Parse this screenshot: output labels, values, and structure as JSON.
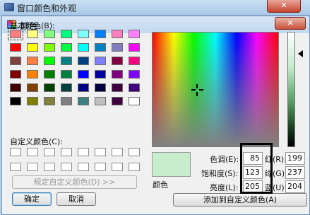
{
  "outer_window": {
    "title": "窗口颜色和外观",
    "close_label": "✕"
  },
  "dialog": {
    "title": "颜色",
    "close_label": "✕",
    "basic_colors_label": "基本颜色(B):",
    "custom_colors_label": "自定义颜色(C):",
    "define_custom_button": "规定自定义颜色(D) >>",
    "ok_button": "确定",
    "cancel_button": "取消",
    "add_custom_button": "添加到自定义颜色(A)",
    "color_solid_label": "颜色",
    "fields": {
      "hue": {
        "label": "色调(E):",
        "value": "85"
      },
      "sat": {
        "label": "饱和度(S):",
        "value": "123"
      },
      "lum": {
        "label": "亮度(L):",
        "value": "205"
      },
      "red": {
        "label": "红(R):",
        "value": "199"
      },
      "green": {
        "label": "绿(G):",
        "value": "237"
      },
      "blue": {
        "label": "蓝(U):",
        "value": "204"
      }
    }
  },
  "basic_colors": [
    "#ff8080",
    "#ffff80",
    "#80ff80",
    "#00ff80",
    "#80ffff",
    "#0080ff",
    "#ff80c0",
    "#ff80ff",
    "#ff0000",
    "#ffff00",
    "#80ff00",
    "#00ff40",
    "#00ffff",
    "#0080c0",
    "#8080c0",
    "#ff00ff",
    "#804040",
    "#ff8040",
    "#00ff00",
    "#008080",
    "#004080",
    "#8080ff",
    "#800040",
    "#ff0080",
    "#800000",
    "#ff8000",
    "#008000",
    "#008040",
    "#0000ff",
    "#0000a0",
    "#800080",
    "#8000ff",
    "#400000",
    "#804000",
    "#004000",
    "#004040",
    "#000080",
    "#000040",
    "#400040",
    "#400080",
    "#000000",
    "#808000",
    "#808040",
    "#808080",
    "#408080",
    "#c0c0c0",
    "#400040",
    "#ffffff"
  ],
  "selected_basic_color_index": 0,
  "selected_color": "#c7edcc",
  "custom_colors_count": 16
}
